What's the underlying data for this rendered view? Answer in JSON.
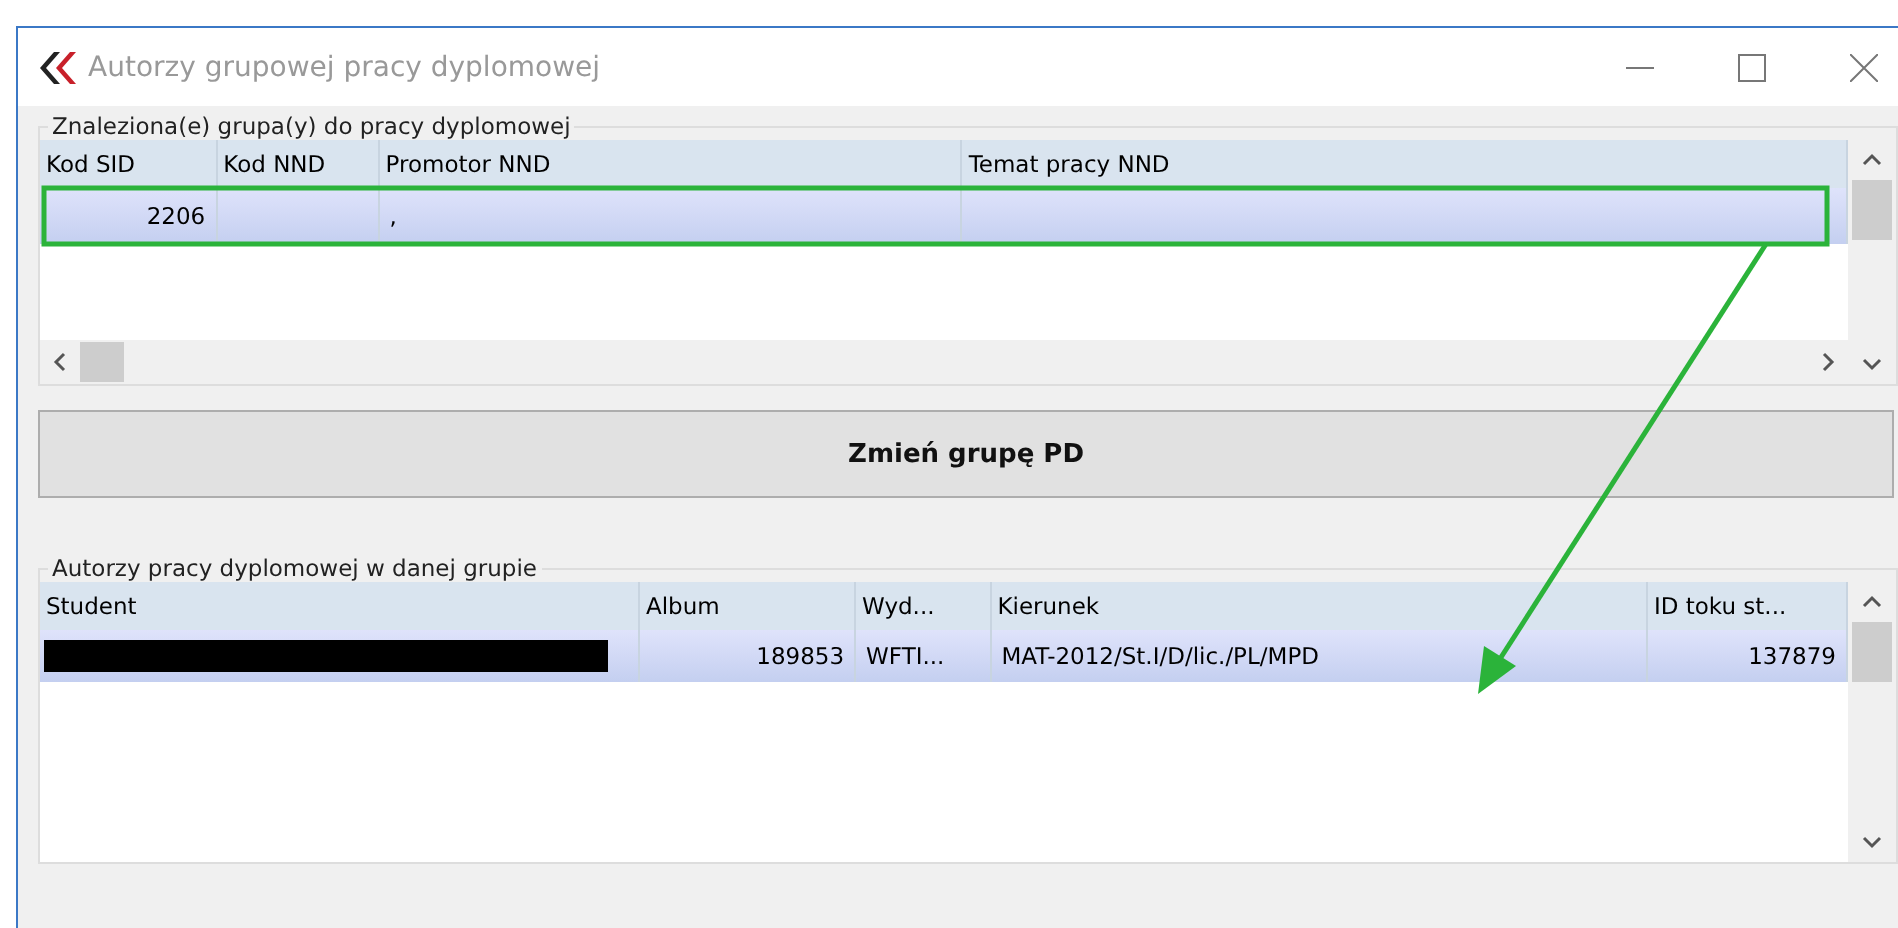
{
  "window": {
    "title": "Autorzy grupowej pracy dyplomowej"
  },
  "groups_panel": {
    "label": "Znaleziona(e) grupa(y) do pracy dyplomowej",
    "columns": [
      "Kod SID",
      "Kod NND",
      "Promotor NND",
      "Temat pracy NND"
    ],
    "rows": [
      {
        "cells": [
          "2206",
          "",
          ",",
          ""
        ],
        "selected": true,
        "highlighted": true
      }
    ]
  },
  "change_button": {
    "label": "Zmień grupę PD"
  },
  "authors_panel": {
    "label": "Autorzy pracy dyplomowej w danej grupie",
    "columns": [
      "Student",
      "Album",
      "Wyd...",
      "Kierunek",
      "ID toku st..."
    ],
    "rows": [
      {
        "cells": [
          "",
          "189853",
          "WFTI...",
          "MAT-2012/St.I/D/lic./PL/MPD",
          "137879"
        ],
        "student_redacted": true,
        "selected": true
      }
    ]
  },
  "annotation_arrow": true
}
